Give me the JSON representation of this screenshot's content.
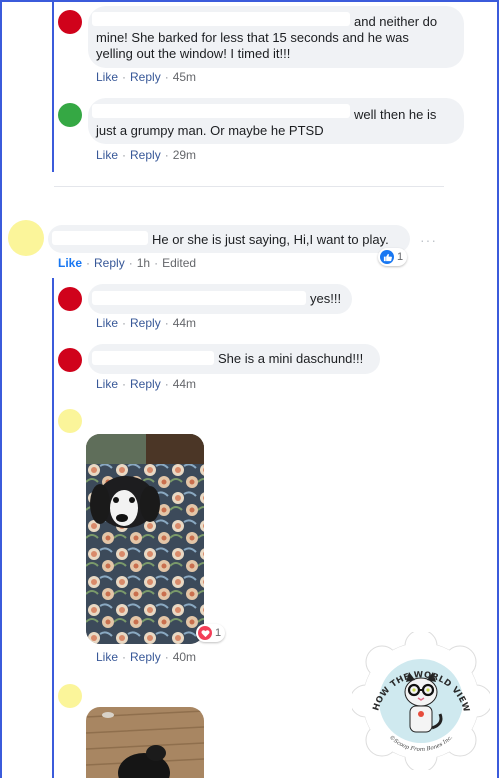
{
  "colors": {
    "accent": "#3b5bdb",
    "link": "#385898",
    "bubble": "#f0f2f5",
    "muted": "#65676b",
    "avatar_red": "#d0021b",
    "avatar_green": "#35a844",
    "avatar_yellow": "#fbf59a",
    "like_blue": "#1877f2",
    "love_red": "#f33e58"
  },
  "comments": [
    {
      "text_line1": "and neither do",
      "text_line2": "mine! She barked for less that 15 seconds and he was",
      "text_line3": "yelling out the window! I timed it!!!",
      "like": "Like",
      "reply": "Reply",
      "time": "45m"
    },
    {
      "text_line1": "well then he is",
      "text_line2": "just a grumpy man. Or maybe he PTSD",
      "like": "Like",
      "reply": "Reply",
      "time": "29m"
    },
    {
      "text": "He or she is just saying, Hi,I want to play.",
      "like": "Like",
      "reply": "Reply",
      "time": "1h",
      "edited": "Edited",
      "reaction_count": "1",
      "more": "···"
    },
    {
      "text": "yes!!!",
      "like": "Like",
      "reply": "Reply",
      "time": "44m"
    },
    {
      "text": "She is a mini daschund!!!",
      "like": "Like",
      "reply": "Reply",
      "time": "44m"
    },
    {
      "photo": "dachshund-on-quilt-photo",
      "reaction_count": "1",
      "like": "Like",
      "reply": "Reply",
      "time": "40m"
    },
    {
      "photo": "dog-on-wood-floor-photo"
    }
  ],
  "watermark": {
    "top_text": "CHANGING HOW THE WORLD VIEWS ANIMALS",
    "credit": "©Scoop From Bones Inc."
  }
}
